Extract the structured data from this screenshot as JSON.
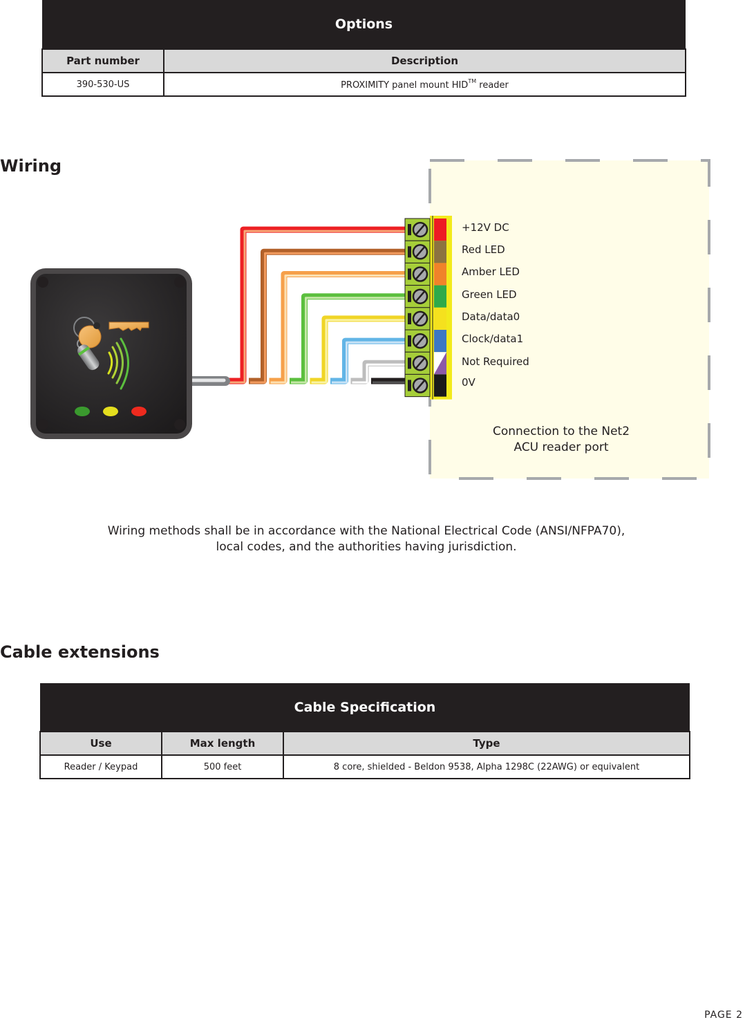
{
  "options_table": {
    "title": "Options",
    "headers": [
      "Part number",
      "Description"
    ],
    "rows": [
      {
        "part_number": "390-530-US",
        "description": "PROXIMITY panel mount HID",
        "description_superscript": "TM",
        "description_suffix": " reader"
      }
    ]
  },
  "wiring": {
    "heading": "Wiring",
    "terminals": [
      {
        "label": "+12V DC",
        "color": "#ed1c24",
        "wire_color": "#ed2024",
        "wire_stripe": "#f7a978"
      },
      {
        "label": "Red LED",
        "color": "#8c7340",
        "wire_color": "#b2612a",
        "wire_stripe": "#f29b5e"
      },
      {
        "label": "Amber LED",
        "color": "#f0832a",
        "wire_color": "#f6a04a",
        "wire_stripe": "#fde0b0"
      },
      {
        "label": "Green LED",
        "color": "#2eaa4a",
        "wire_color": "#5bbf3e",
        "wire_stripe": "#c4e7a6"
      },
      {
        "label": "Data/data0",
        "color": "#f5e11e",
        "wire_color": "#f0d526",
        "wire_stripe": "#faf3a4"
      },
      {
        "label": "Clock/data1",
        "color": "#3d78c4",
        "wire_color": "#62b5e6",
        "wire_stripe": "#c7e2f6"
      },
      {
        "label": "Not Required",
        "color": "#8c5aa8",
        "wire_color": "#bdbdbd",
        "wire_stripe": "#ffffff"
      },
      {
        "label": "0V",
        "color": "#1a1a1a",
        "wire_color": "#231f20",
        "wire_stripe": "#555555"
      }
    ],
    "acu_caption_line1": "Connection to the Net2",
    "acu_caption_line2": "ACU reader port",
    "reader_leds": [
      "#3a9a2e",
      "#e4de1e",
      "#ee2a1e"
    ],
    "note_line1": "Wiring methods shall be in accordance with the National Electrical Code (ANSI/NFPA70),",
    "note_line2": "local codes, and the authorities having jurisdiction."
  },
  "cable_extensions": {
    "heading": "Cable extensions",
    "table": {
      "title": "Cable Specification",
      "headers": [
        "Use",
        "Max length",
        "Type"
      ],
      "rows": [
        {
          "use": "Reader / Keypad",
          "max_length": "500 feet",
          "type": "8 core, shielded -  Beldon 9538, Alpha 1298C (22AWG)  or equivalent"
        }
      ]
    }
  },
  "footer": {
    "page_label": "PAGE  2"
  }
}
